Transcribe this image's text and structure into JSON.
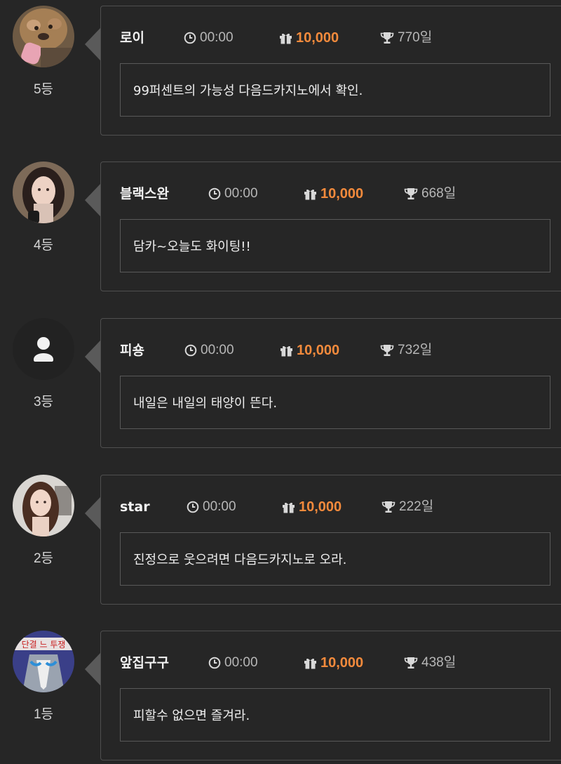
{
  "entries": [
    {
      "nickname": "로이",
      "time": "00:00",
      "gift": "10,000",
      "streak": "770일",
      "message": "99퍼센트의 가능성 다음드카지노에서 확인.",
      "rank": "5등",
      "avatar": "dog-photo"
    },
    {
      "nickname": "블랙스완",
      "time": "00:00",
      "gift": "10,000",
      "streak": "668일",
      "message": "담카~오늘도 화이팅!!",
      "rank": "4등",
      "avatar": "woman-photo"
    },
    {
      "nickname": "피숑",
      "time": "00:00",
      "gift": "10,000",
      "streak": "732일",
      "message": "내일은 내일의 태양이 뜬다.",
      "rank": "3등",
      "avatar": "default-user-icon"
    },
    {
      "nickname": "star",
      "time": "00:00",
      "gift": "10,000",
      "streak": "222일",
      "message": "진정으로 웃으려면 다음드카지노로 오라.",
      "rank": "2등",
      "avatar": "woman-photo"
    },
    {
      "nickname": "앞집구구",
      "time": "00:00",
      "gift": "10,000",
      "streak": "438일",
      "message": "피할수 없으면 즐겨라.",
      "rank": "1등",
      "avatar": "cartoon-character",
      "avatar_caption": "단결 느 투쟁"
    }
  ],
  "colors": {
    "background": "#262626",
    "border": "#4f4f4f",
    "gift_accent": "#f28a3c",
    "muted_text": "#b7b7b7"
  },
  "icons": {
    "time": "clock-icon",
    "gift": "gift-icon",
    "streak": "trophy-icon"
  }
}
